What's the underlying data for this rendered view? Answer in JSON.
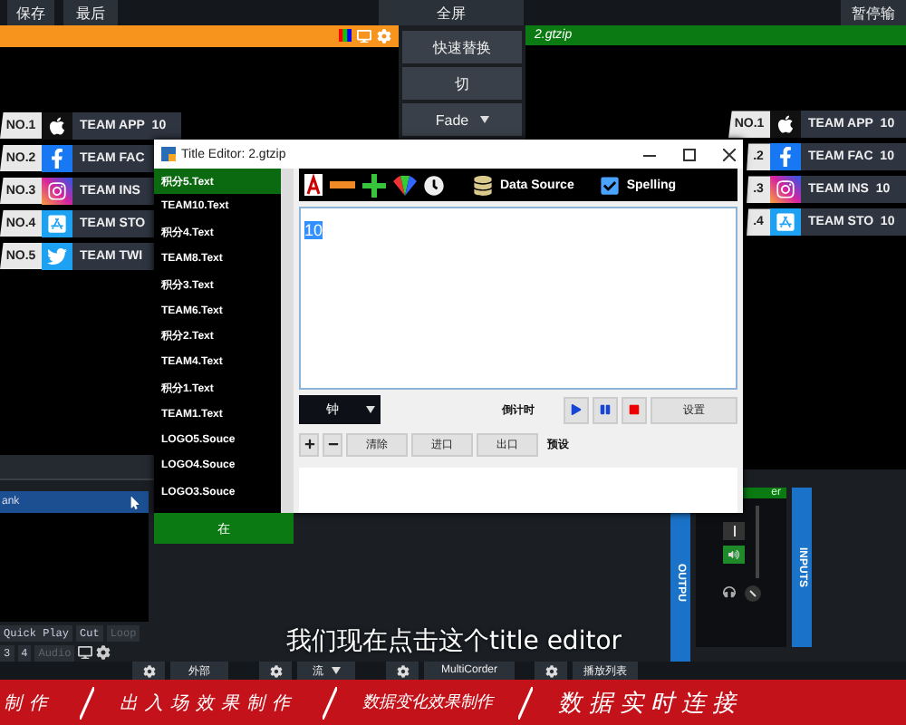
{
  "top_bar": {
    "left_buttons": [
      "保存",
      "最后"
    ],
    "fullscreen": "全屏",
    "right_button": "暂停输"
  },
  "transitions": [
    {
      "label": "快速替换",
      "dropdown": false
    },
    {
      "label": "切",
      "dropdown": false
    },
    {
      "label": "Fade",
      "dropdown": true
    }
  ],
  "output": {
    "title": "2.gtzip"
  },
  "lower_thirds_left": [
    {
      "tag": "NO.1",
      "kind": "apple",
      "team": "TEAM APP",
      "score": "10"
    },
    {
      "tag": "NO.2",
      "kind": "facebook",
      "team": "TEAM FAC"
    },
    {
      "tag": "NO.3",
      "kind": "instagram",
      "team": "TEAM INS"
    },
    {
      "tag": "NO.4",
      "kind": "appstore",
      "team": "TEAM STO"
    },
    {
      "tag": "NO.5",
      "kind": "twitter",
      "team": "TEAM TWI"
    }
  ],
  "lower_thirds_right": [
    {
      "tag": "NO.1",
      "kind": "apple",
      "team": "TEAM APP",
      "score": "10"
    },
    {
      "tag": ".2",
      "kind": "facebook",
      "team": "TEAM FAC",
      "score": "10"
    },
    {
      "tag": ".3",
      "kind": "instagram",
      "team": "TEAM INS",
      "score": "10"
    },
    {
      "tag": ".4",
      "kind": "appstore",
      "team": "TEAM STO",
      "score": "10"
    }
  ],
  "editor": {
    "title": "Title Editor: 2.gtzip",
    "items": [
      {
        "label": "积分5.Text",
        "selected": true
      },
      {
        "label": "TEAM10.Text",
        "selected": false
      },
      {
        "label": "积分4.Text",
        "selected": false
      },
      {
        "label": "TEAM8.Text",
        "selected": false
      },
      {
        "label": "积分3.Text",
        "selected": false
      },
      {
        "label": "TEAM6.Text",
        "selected": false
      },
      {
        "label": "积分2.Text",
        "selected": false
      },
      {
        "label": "TEAM4.Text",
        "selected": false
      },
      {
        "label": "积分1.Text",
        "selected": false
      },
      {
        "label": "TEAM1.Text",
        "selected": false
      },
      {
        "label": "LOGO5.Souce",
        "selected": false
      },
      {
        "label": "LOGO4.Souce",
        "selected": false
      },
      {
        "label": "LOGO3.Souce",
        "selected": false
      }
    ],
    "data_source": "Data Source",
    "spelling": "Spelling",
    "text": "10",
    "clock_select": "钟",
    "countdown": "倒计时",
    "settings": "设置",
    "buttons": [
      "清除",
      "进口",
      "出口"
    ],
    "preset": "预设"
  },
  "apply_button": "在",
  "inputs": {
    "selected_row": "ank",
    "tabs": [
      {
        "label": "Quick Play",
        "disabled": false
      },
      {
        "label": "Cut",
        "disabled": false
      },
      {
        "label": "Loop",
        "disabled": true
      }
    ],
    "numbers": [
      "3",
      "4"
    ],
    "audio": "Audio"
  },
  "audio": {
    "bus": "er",
    "outputs": "OUTPU",
    "inputs": "INPUTS"
  },
  "subtitle": "我们现在点击这个title editor",
  "bottom_bar": [
    {
      "label": "外部",
      "dropdown": false
    },
    {
      "label": "流",
      "dropdown": true
    },
    {
      "label": "MultiCorder",
      "dropdown": false
    },
    {
      "label": "播放列表",
      "dropdown": false
    }
  ],
  "banner": [
    "制作",
    "出入场效果制作",
    "数据变化效果制作",
    "数据实时连接"
  ]
}
